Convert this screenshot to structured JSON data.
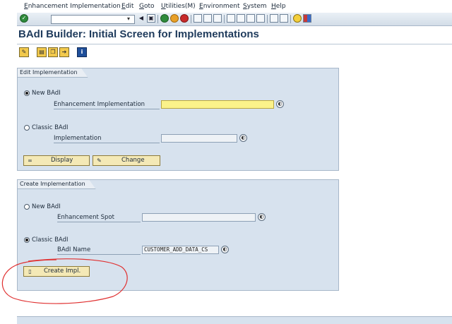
{
  "menu": [
    "Enhancement Implementation",
    "Edit",
    "Goto",
    "Utilities(M)",
    "Environment",
    "System",
    "Help"
  ],
  "toolbar": {
    "enter_icon": "✓",
    "dropdown_icon": "▾",
    "back_icon": "◀",
    "save_icon": "▣"
  },
  "title": "BAdI Builder: Initial Screen for Implementations",
  "edit_section": {
    "heading": "Edit Implementation",
    "new_badi": "New BAdI",
    "enh_impl_label": "Enhancement Implementation",
    "enh_impl_value": "",
    "classic_badi": "Classic BAdI",
    "impl_label": "Implementation",
    "impl_value": "",
    "display_label": "Display",
    "change_label": "Change"
  },
  "create_section": {
    "heading": "Create Implementation",
    "new_badi": "New BAdI",
    "enh_spot_label": "Enhancement Spot",
    "enh_spot_value": "",
    "classic_badi": "Classic BAdI",
    "badi_name_label": "BAdI Name",
    "badi_name_value": "CUSTOMER_ADD_DATA_CS",
    "create_label": "Create Impl."
  },
  "annotation_color": "#e03030"
}
